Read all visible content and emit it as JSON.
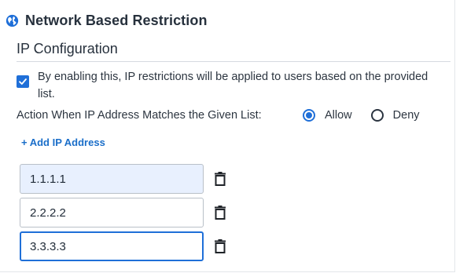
{
  "section": {
    "title": "Network Based Restriction",
    "icon": "globe-icon"
  },
  "ip_config": {
    "title": "IP Configuration",
    "enable_checkbox": {
      "checked": true,
      "label": "By enabling this, IP restrictions will be applied to users based on the provided list."
    },
    "action": {
      "label": "Action When IP Address Matches the Given List:",
      "options": [
        {
          "label": "Allow",
          "selected": true
        },
        {
          "label": "Deny",
          "selected": false
        }
      ]
    },
    "add_link": "+ Add IP Address",
    "ip_addresses": [
      {
        "value": "1.1.1.1"
      },
      {
        "value": "2.2.2.2"
      },
      {
        "value": "3.3.3.3"
      }
    ]
  },
  "colors": {
    "accent": "#1f6fd8",
    "link": "#1a6ec9",
    "autofill_bg": "#e8f0fe",
    "text": "#2c3540"
  }
}
